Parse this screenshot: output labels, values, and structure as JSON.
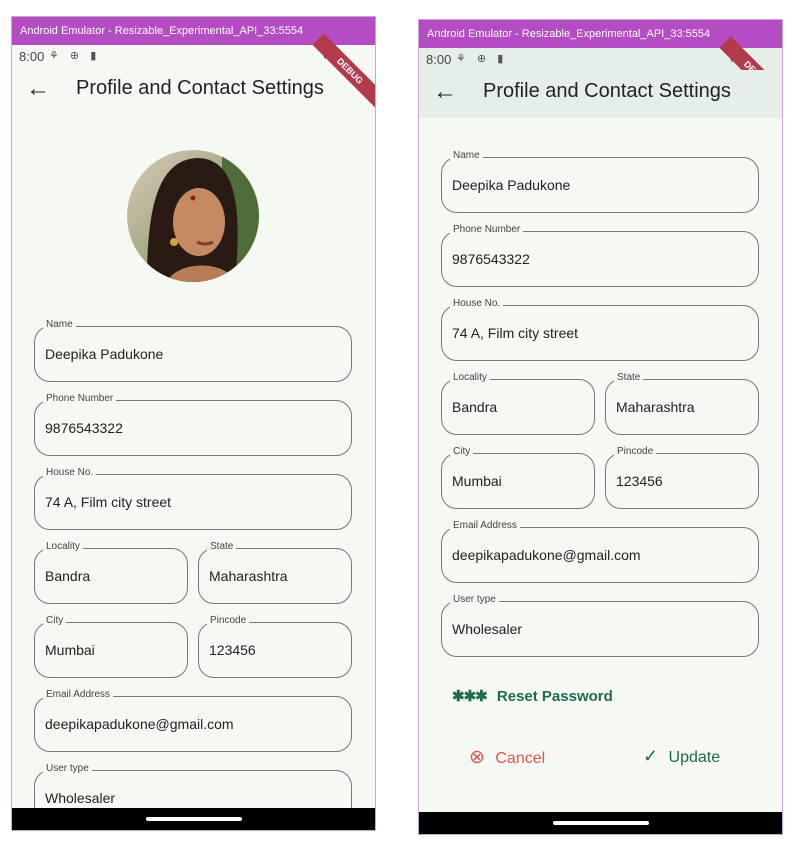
{
  "emulator": {
    "window_title": "Android Emulator - Resizable_Experimental_API_33:5554"
  },
  "status_bar": {
    "time": "8:00",
    "debug_label": "DEBUG"
  },
  "appbar": {
    "title": "Profile and Contact Settings"
  },
  "fields": {
    "name": {
      "label": "Name",
      "value": "Deepika Padukone"
    },
    "phone": {
      "label": "Phone Number",
      "value": "9876543322"
    },
    "house": {
      "label": "House No.",
      "value": "74 A, Film city street"
    },
    "locality": {
      "label": "Locality",
      "value": "Bandra"
    },
    "state": {
      "label": "State",
      "value": "Maharashtra"
    },
    "city": {
      "label": "City",
      "value": "Mumbai"
    },
    "pincode": {
      "label": "Pincode",
      "value": "123456"
    },
    "email": {
      "label": "Email Address",
      "value": "deepikapadukone@gmail.com"
    },
    "usertype": {
      "label": "User type",
      "value": "Wholesaler"
    }
  },
  "actions": {
    "reset_password": "Reset Password",
    "cancel": "Cancel",
    "update": "Update"
  },
  "colors": {
    "titlebar": "#b44cc4",
    "accent_green": "#1f6b4a",
    "cancel_red": "#e0574f",
    "background": "#f6f8f4"
  }
}
